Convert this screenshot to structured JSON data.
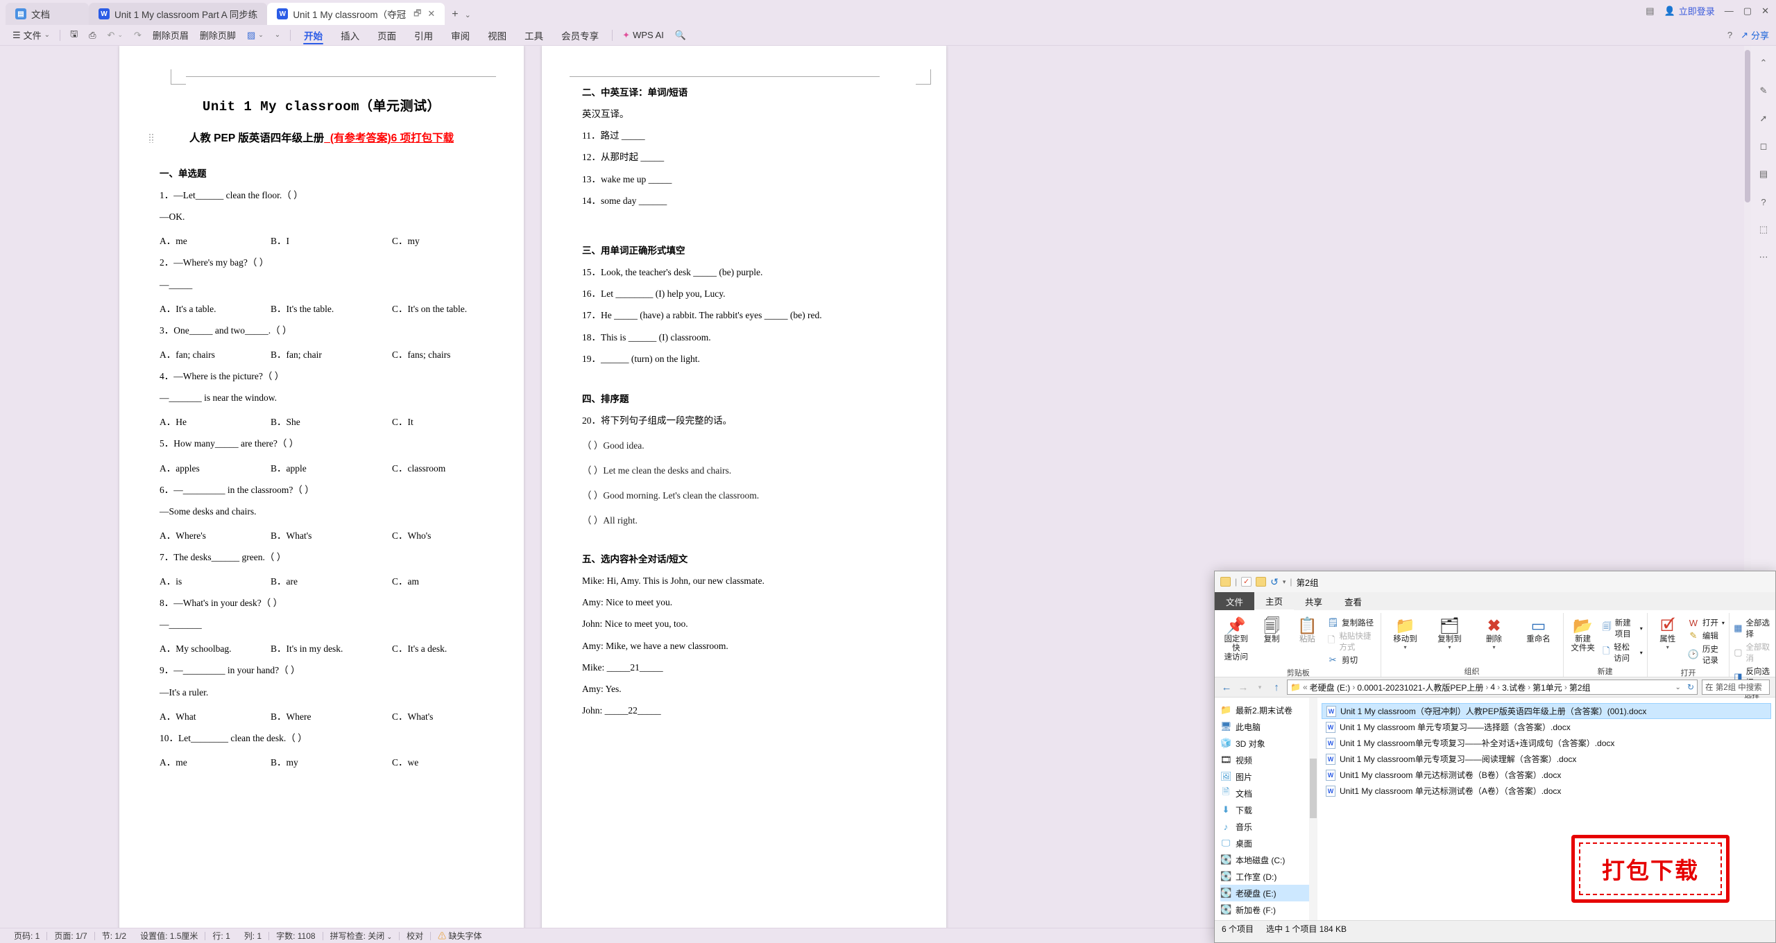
{
  "titlebar": {
    "home_tab": "文档",
    "tabs": [
      {
        "label": "Unit 1 My classroom Part A 同步练",
        "icon": "word-icon"
      },
      {
        "label": "Unit 1 My classroom（夺冠",
        "icon": "word-icon"
      }
    ],
    "new_tab": "+",
    "chevron": "⌄",
    "share_label": "分享",
    "login_label": "立即登录"
  },
  "ribbon": {
    "file_menu": "文件",
    "quick": [
      "save-icon",
      "print-preview-icon",
      "undo-icon",
      "redo-icon"
    ],
    "commands": [
      "删除页眉",
      "删除页脚"
    ],
    "tabs": [
      {
        "label": "开始",
        "selected": true
      },
      {
        "label": "插入",
        "selected": false
      },
      {
        "label": "页面",
        "selected": false
      },
      {
        "label": "引用",
        "selected": false
      },
      {
        "label": "审阅",
        "selected": false
      },
      {
        "label": "视图",
        "selected": false
      },
      {
        "label": "工具",
        "selected": false
      },
      {
        "label": "会员专享",
        "selected": false
      }
    ],
    "ai_label": "WPS AI",
    "search_icon": "search-icon"
  },
  "document": {
    "title": "Unit 1 My classroom（单元测试）",
    "subtitle_black": "人教 PEP 版英语四年级上册",
    "subtitle_red": "_(有参考答案)6 项打包下载",
    "section1": {
      "heading": "一、单选题",
      "items": [
        {
          "q": "1．—Let______ clean the floor.（    ）",
          "q2": "—OK.",
          "a": "A．me",
          "b": "B．I",
          "c": "C．my"
        },
        {
          "q": "2．—Where's my bag?（    ）",
          "q2": "—_____",
          "a": "A．It's a table.",
          "b": "B．It's the table.",
          "c": "C．It's on the table."
        },
        {
          "q": "3．One_____ and two_____.（    ）",
          "q2": "",
          "a": "A．fan; chairs",
          "b": "B．fan; chair",
          "c": "C．fans; chairs"
        },
        {
          "q": "4．—Where is the picture?（    ）",
          "q2": "—_______ is near the window.",
          "a": "A．He",
          "b": "B．She",
          "c": "C．It"
        },
        {
          "q": "5．How many_____ are there?（    ）",
          "q2": "",
          "a": "A．apples",
          "b": "B．apple",
          "c": "C．classroom"
        },
        {
          "q": "6．—_________ in the classroom?（    ）",
          "q2": "—Some desks and chairs.",
          "a": "A．Where's",
          "b": "B．What's",
          "c": "C．Who's"
        },
        {
          "q": "7．The desks______ green.（    ）",
          "q2": "",
          "a": "A．is",
          "b": "B．are",
          "c": "C．am"
        },
        {
          "q": "8．—What's in your desk?（    ）",
          "q2": "—_______",
          "a": "A．My schoolbag.",
          "b": "B．It's in my desk.",
          "c": "C．It's a desk."
        },
        {
          "q": "9．—_________ in your hand?（    ）",
          "q2": "—It's a ruler.",
          "a": "A．What",
          "b": "B．Where",
          "c": "C．What's"
        },
        {
          "q": "10．Let________ clean the desk.（    ）",
          "q2": "",
          "a": "A．me",
          "b": "B．my",
          "c": "C．we"
        }
      ]
    },
    "section2": {
      "heading": "二、中英互译：单词/短语",
      "intro": "英汉互译。",
      "items": [
        "11．路过 _____",
        "12．从那时起 _____",
        "13．wake me up _____",
        "14．some day ______"
      ]
    },
    "section3": {
      "heading": "三、用单词正确形式填空",
      "items": [
        "15．Look, the teacher's desk _____ (be) purple.",
        "16．Let ________ (I) help you, Lucy.",
        "17．He _____ (have) a rabbit. The rabbit's eyes _____ (be) red.",
        "18．This is ______ (I) classroom.",
        "19．______ (turn) on the light."
      ]
    },
    "section4": {
      "heading": "四、排序题",
      "intro": "20．将下列句子组成一段完整的话。",
      "items": [
        "（     ）Good idea.",
        "（     ）Let me clean the desks and chairs.",
        "（     ）Good morning. Let's clean the classroom.",
        "（     ）All right."
      ]
    },
    "section5": {
      "heading": "五、选内容补全对话/短文",
      "lines": [
        "Mike: Hi, Amy. This is John, our new classmate.",
        "Amy: Nice to meet you.",
        "John: Nice to meet you, too.",
        "Amy: Mike, we have a new classroom.",
        "Mike: _____21_____",
        "Amy: Yes.",
        "John: _____22_____"
      ]
    }
  },
  "statusbar": {
    "items": [
      "页码: 1",
      "页面: 1/7",
      "节: 1/2",
      "设置值: 1.5厘米",
      "行: 1",
      "列: 1",
      "字数: 1108",
      "拼写检查: 关闭",
      "校对",
      "缺失字体"
    ],
    "warn_icon": "warning-icon"
  },
  "explorer": {
    "window_title": "第2组",
    "quick_access": [
      "folder-icon",
      "checked-doc-icon",
      "folder-icon",
      "undo-icon",
      "chevron-down-icon"
    ],
    "menus": [
      {
        "label": "文件",
        "active": true
      },
      {
        "label": "主页",
        "active": false
      },
      {
        "label": "共享",
        "active": false
      },
      {
        "label": "查看",
        "active": false
      }
    ],
    "groups": [
      {
        "name": "剪贴板",
        "big": [
          {
            "label": "固定到快\n速访问",
            "icon": "pin-icon"
          },
          {
            "label": "复制",
            "icon": "copy-icon"
          },
          {
            "label": "粘贴",
            "icon": "paste-icon"
          }
        ],
        "small": [
          {
            "label": "复制路径",
            "icon": "copy-path-icon",
            "dim": false
          },
          {
            "label": "粘贴快捷方式",
            "icon": "paste-shortcut-icon",
            "dim": true
          },
          {
            "label": "剪切",
            "icon": "scissors-icon",
            "dim": false
          }
        ]
      },
      {
        "name": "组织",
        "big": [
          {
            "label": "移动到",
            "icon": "move-to-icon"
          },
          {
            "label": "复制到",
            "icon": "copy-to-icon"
          },
          {
            "label": "删除",
            "icon": "delete-icon"
          },
          {
            "label": "重命名",
            "icon": "rename-icon"
          }
        ],
        "small": []
      },
      {
        "name": "新建",
        "big": [
          {
            "label": "新建\n文件夹",
            "icon": "new-folder-icon"
          }
        ],
        "small": [
          {
            "label": "新建项目",
            "icon": "new-item-icon",
            "dim": false
          },
          {
            "label": "轻松访问",
            "icon": "easy-access-icon",
            "dim": false
          }
        ]
      },
      {
        "name": "打开",
        "big": [
          {
            "label": "属性",
            "icon": "properties-icon"
          }
        ],
        "small": [
          {
            "label": "打开",
            "icon": "open-icon",
            "dim": false
          },
          {
            "label": "编辑",
            "icon": "edit-icon",
            "dim": false
          },
          {
            "label": "历史记录",
            "icon": "history-icon",
            "dim": false
          }
        ]
      },
      {
        "name": "选择",
        "big": [],
        "small": [
          {
            "label": "全部选择",
            "icon": "select-all-icon",
            "dim": false
          },
          {
            "label": "全部取消",
            "icon": "select-none-icon",
            "dim": true
          },
          {
            "label": "反向选择",
            "icon": "invert-selection-icon",
            "dim": false
          }
        ]
      }
    ],
    "breadcrumb": [
      "老硬盘 (E:)",
      "0.0001-20231021-人教版PEP上册",
      "4",
      "3.试卷",
      "第1单元",
      "第2组"
    ],
    "search_placeholder": "在 第2组 中搜索",
    "nav_items": [
      {
        "label": "最新2.期末试卷",
        "icon": "folder-icon"
      },
      {
        "label": "此电脑",
        "icon": "this-pc-icon"
      },
      {
        "label": "3D 对象",
        "icon": "3d-objects-icon"
      },
      {
        "label": "视频",
        "icon": "videos-icon"
      },
      {
        "label": "图片",
        "icon": "pictures-icon"
      },
      {
        "label": "文档",
        "icon": "documents-icon"
      },
      {
        "label": "下载",
        "icon": "downloads-icon"
      },
      {
        "label": "音乐",
        "icon": "music-icon"
      },
      {
        "label": "桌面",
        "icon": "desktop-icon"
      },
      {
        "label": "本地磁盘 (C:)",
        "icon": "drive-icon"
      },
      {
        "label": "工作室 (D:)",
        "icon": "drive-icon"
      },
      {
        "label": "老硬盘 (E:)",
        "icon": "drive-icon"
      },
      {
        "label": "新加卷 (F:)",
        "icon": "drive-icon"
      }
    ],
    "files": [
      {
        "name": "Unit 1 My classroom（夺冠冲刺）人教PEP版英语四年级上册（含答案）(001).docx",
        "selected": true
      },
      {
        "name": "Unit 1 My classroom 单元专项复习——选择题（含答案）.docx",
        "selected": false
      },
      {
        "name": "Unit 1 My classroom单元专项复习——补全对话+连词成句（含答案）.docx",
        "selected": false
      },
      {
        "name": "Unit 1 My classroom单元专项复习——阅读理解（含答案）.docx",
        "selected": false
      },
      {
        "name": "Unit1 My classroom 单元达标测试卷（B卷）（含答案）.docx",
        "selected": false
      },
      {
        "name": "Unit1 My classroom 单元达标测试卷（A卷）（含答案）.docx",
        "selected": false
      }
    ],
    "status": [
      "6 个项目",
      "选中 1 个项目  184 KB"
    ]
  },
  "stamp": {
    "text": "打包下载"
  },
  "colors": {
    "accent": "#2b5ce6",
    "red": "#ff0000",
    "selection": "#cce8ff"
  }
}
